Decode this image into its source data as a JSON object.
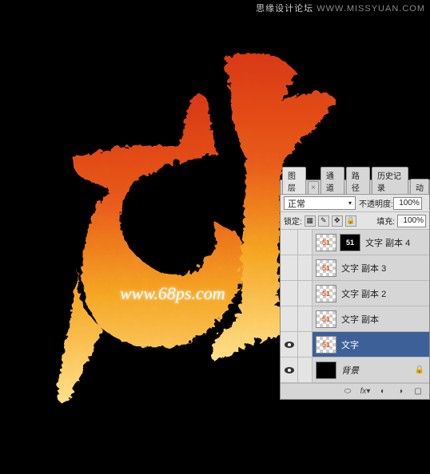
{
  "watermark_top_cn": "思缘设计论坛",
  "watermark_top_url": "WWW.MISSYUAN.COM",
  "watermark_center": "www.68ps.com",
  "artwork_text": "51",
  "panel": {
    "tabs": {
      "layers": "图层",
      "channels": "通道",
      "paths": "路径",
      "history": "历史记录",
      "actions": "动"
    },
    "blend_mode": "正常",
    "opacity_label": "不透明度:",
    "opacity_value": "100%",
    "lock_label": "锁定:",
    "fill_label": "填充:",
    "fill_value": "100%",
    "layers": [
      {
        "name": "文字 副本 4",
        "visible": false,
        "thumb": "dark"
      },
      {
        "name": "文字 副本 3",
        "visible": false,
        "thumb": "checker"
      },
      {
        "name": "文字 副本 2",
        "visible": false,
        "thumb": "checker"
      },
      {
        "name": "文字 副本",
        "visible": false,
        "thumb": "checker"
      },
      {
        "name": "文字",
        "visible": true,
        "thumb": "checker",
        "selected": true
      },
      {
        "name": "背景",
        "visible": true,
        "thumb": "solid-black",
        "locked": true
      }
    ],
    "footer_icons": [
      "link",
      "fx",
      "mask",
      "adjust",
      "group",
      "new",
      "trash"
    ]
  }
}
